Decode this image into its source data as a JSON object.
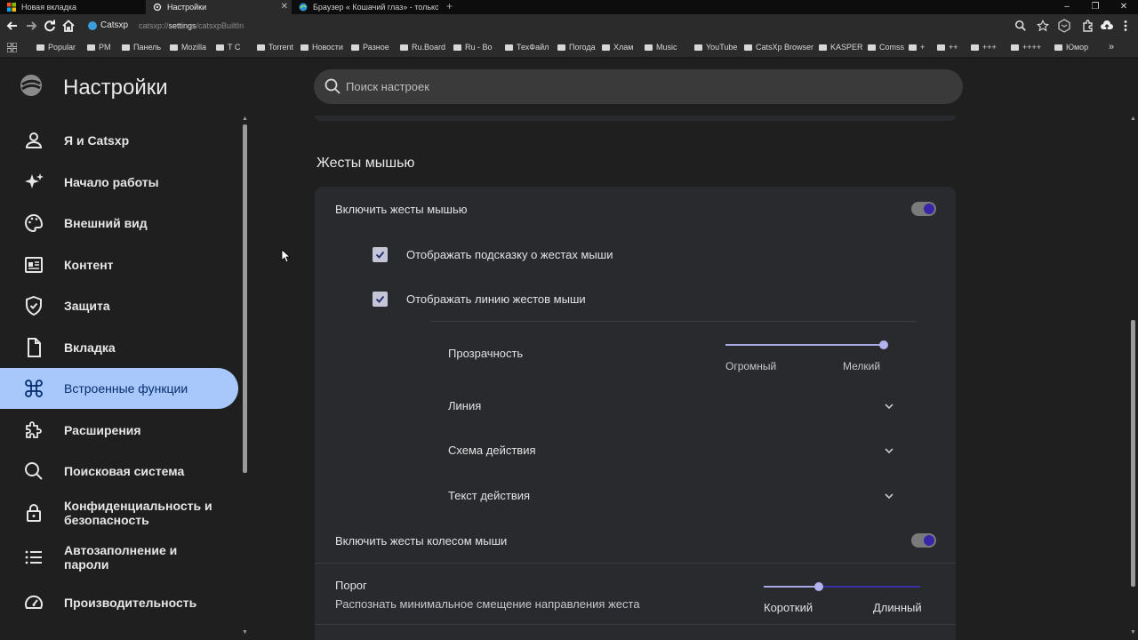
{
  "tabs": [
    {
      "label": "Новая вкладка"
    },
    {
      "label": "Настройки"
    },
    {
      "label": "Браузер « Кошачий глаз» - только"
    }
  ],
  "new_tab": "+",
  "window": {
    "minimize": "–",
    "maximize": "❐",
    "close": "✕"
  },
  "toolbar": {
    "site_name": "Catsxp",
    "url_prefix": "catsxp://",
    "url_path": "settings",
    "url_rest": "/catsxpBuiltIn"
  },
  "bookmarks": [
    {
      "label": "Popular"
    },
    {
      "label": "PM"
    },
    {
      "label": "Панель"
    },
    {
      "label": "Mozilla"
    },
    {
      "label": "T C"
    },
    {
      "label": "Torrent"
    },
    {
      "label": "Новости"
    },
    {
      "label": "Разное"
    },
    {
      "label": "Ru.Board"
    },
    {
      "label": "Ru - Bo"
    },
    {
      "label": "ТехФайл"
    },
    {
      "label": "Погода"
    },
    {
      "label": "Хлам"
    },
    {
      "label": "Music"
    },
    {
      "label": "YouTube"
    },
    {
      "label": "CatsXp Browser"
    },
    {
      "label": "KASPER"
    },
    {
      "label": "Comss"
    },
    {
      "label": "+"
    },
    {
      "label": "++"
    },
    {
      "label": "+++"
    },
    {
      "label": "++++"
    },
    {
      "label": "Юмор"
    }
  ],
  "bookmarks_more": "»",
  "header": {
    "title": "Настройки",
    "search_placeholder": "Поиск настроек"
  },
  "sidebar": {
    "items": [
      {
        "label": "Я и Catsxp",
        "icon": "person-icon"
      },
      {
        "label": "Начало работы",
        "icon": "sparkle-icon"
      },
      {
        "label": "Внешний вид",
        "icon": "palette-icon"
      },
      {
        "label": "Контент",
        "icon": "content-icon"
      },
      {
        "label": "Защита",
        "icon": "shield-icon"
      },
      {
        "label": "Вкладка",
        "icon": "document-icon"
      },
      {
        "label": "Встроенные функции",
        "icon": "command-icon",
        "active": true
      },
      {
        "label": "Расширения",
        "icon": "puzzle-icon"
      },
      {
        "label": "Поисковая система",
        "icon": "search-icon"
      },
      {
        "label": "Конфиденциальность и безопасность",
        "icon": "lock-icon"
      },
      {
        "label": "Автозаполнение и пароли",
        "icon": "list-icon"
      },
      {
        "label": "Производительность",
        "icon": "speedometer-icon"
      }
    ]
  },
  "section": {
    "title": "Жесты мышью",
    "enable_gestures": {
      "label": "Включить жесты мышью",
      "on": true
    },
    "show_hint": {
      "label": "Отображать подсказку о жестах мыши",
      "checked": true
    },
    "show_line": {
      "label": "Отображать линию жестов мыши",
      "checked": true
    },
    "transparency": {
      "label": "Прозрачность",
      "min_label": "Огромный",
      "max_label": "Мелкий",
      "value_fraction": 1.0
    },
    "line": {
      "label": "Линия"
    },
    "action_scheme": {
      "label": "Схема действия"
    },
    "action_text": {
      "label": "Текст действия"
    },
    "enable_wheel": {
      "label": "Включить жесты колесом мыши",
      "on": true
    },
    "threshold": {
      "label": "Порог",
      "description": "Распознать минимальное смещение направления жеста",
      "min_label": "Короткий",
      "max_label": "Длинный",
      "value_fraction": 0.35
    }
  },
  "colors": {
    "accent_active_nav": "#a8c7fa",
    "toggle_knob": "#3826a8",
    "card_bg": "#292a2d"
  }
}
